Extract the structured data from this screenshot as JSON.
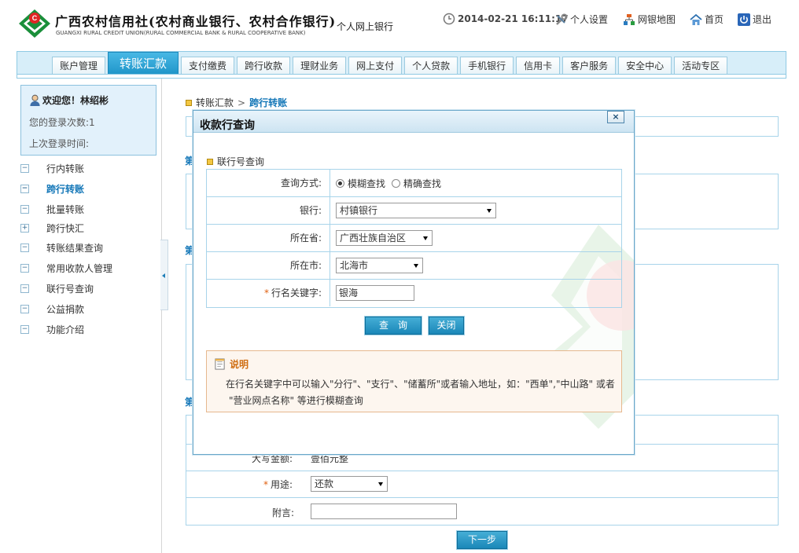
{
  "header": {
    "bank_name_cn": "广西农村信用社(农村商业银行、农村合作银行)",
    "bank_name_en": "GUANGXI RURAL CREDIT UNION(RURAL COMMERCIAL BANK & RURAL COOPERATIVE BANK)",
    "product": "个人网上银行",
    "datetime": "2014-02-21 16:11:17",
    "links": [
      "个人设置",
      "网银地图",
      "首页",
      "退出"
    ],
    "icons": [
      "clock-icon",
      "tools-icon",
      "sitemap-icon",
      "home-icon",
      "power-icon"
    ]
  },
  "nav": {
    "tabs": [
      "账户管理",
      "转账汇款",
      "支付缴费",
      "跨行收款",
      "理财业务",
      "网上支付",
      "个人贷款",
      "手机银行",
      "信用卡",
      "客户服务",
      "安全中心",
      "活动专区"
    ],
    "active": "转账汇款"
  },
  "sidebar": {
    "welcome": "欢迎您！林绍彬",
    "login_count": "您的登录次数:1",
    "last_login": "上次登录时间:",
    "items": [
      {
        "label": "行内转账",
        "box": "−"
      },
      {
        "label": "跨行转账",
        "box": "−"
      },
      {
        "label": "批量转账",
        "box": "−"
      },
      {
        "label": "跨行快汇",
        "box": "+"
      },
      {
        "label": "转账结果查询",
        "box": "−"
      },
      {
        "label": "常用收款人管理",
        "box": "−"
      },
      {
        "label": "联行号查询",
        "box": "−"
      },
      {
        "label": "公益捐款",
        "box": "−"
      },
      {
        "label": "功能介绍",
        "box": "−"
      }
    ],
    "active": "跨行转账"
  },
  "breadcrumb": {
    "parent": "转账汇款",
    "sep": ">",
    "current": "跨行转账"
  },
  "background_form": {
    "section_char": "第",
    "amount_label": "大写金额:",
    "amount_value": "壹佰元整",
    "purpose_label": "用途:",
    "purpose_value": "还款",
    "note_label": "附言:",
    "next_button": "下一步"
  },
  "modal": {
    "title": "收款行查询",
    "close": "×",
    "section": "联行号查询",
    "query_mode_label": "查询方式:",
    "query_modes": [
      "模糊查找",
      "精确查找"
    ],
    "query_mode_selected": "模糊查找",
    "bank_label": "银行:",
    "bank_value": "村镇银行",
    "province_label": "所在省:",
    "province_value": "广西壮族自治区",
    "city_label": "所在市:",
    "city_value": "北海市",
    "keyword_label": "行名关键字:",
    "keyword_value": "银海",
    "query_button": "查　询",
    "close_button": "关闭",
    "note_title": "说明",
    "note_line1": "在行名关键字中可以输入\"分行\"、\"支行\"、\"储蓄所\"或者输入地址，如：\"西单\",\"中山路\" 或者",
    "note_line2": "\"营业网点名称\" 等进行模糊查询"
  },
  "colors": {
    "accent": "#1477b8",
    "nav_active": "#2aa1d4",
    "border": "#a8d4ea",
    "required": "#e06010"
  }
}
